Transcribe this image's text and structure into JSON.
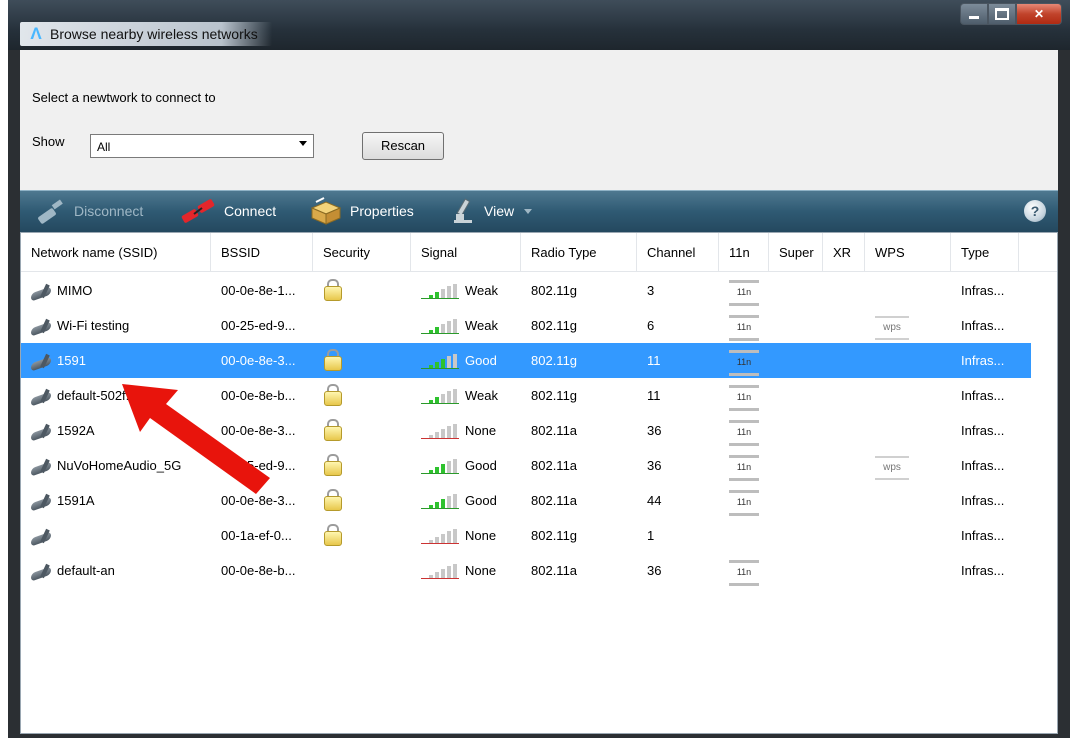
{
  "window": {
    "title": "Browse nearby wireless networks",
    "app_icon_glyph": "Λ"
  },
  "prompt": "Select a newtwork to connect to",
  "show": {
    "label": "Show",
    "selected": "All"
  },
  "rescan_label": "Rescan",
  "toolbar": {
    "disconnect": "Disconnect",
    "connect": "Connect",
    "properties": "Properties",
    "view": "View",
    "help_glyph": "?"
  },
  "columns": [
    "Network name (SSID)",
    "BSSID",
    "Security",
    "Signal",
    "Radio Type",
    "Channel",
    "11n",
    "Super",
    "XR",
    "WPS",
    "Type"
  ],
  "networks": [
    {
      "ssid": "MIMO",
      "bssid": "00-0e-8e-1...",
      "secure": true,
      "signal": "Weak",
      "bars": 2,
      "radio": "802.11g",
      "channel": "3",
      "n11": true,
      "wps": false,
      "type": "Infras...",
      "selected": false
    },
    {
      "ssid": "Wi-Fi testing",
      "bssid": "00-25-ed-9...",
      "secure": false,
      "signal": "Weak",
      "bars": 2,
      "radio": "802.11g",
      "channel": "6",
      "n11": true,
      "wps": true,
      "type": "Infras...",
      "selected": false
    },
    {
      "ssid": "1591",
      "bssid": "00-0e-8e-3...",
      "secure": true,
      "signal": "Good",
      "bars": 3,
      "radio": "802.11g",
      "channel": "11",
      "n11": true,
      "wps": false,
      "type": "Infras...",
      "selected": true
    },
    {
      "ssid": "default-502f...",
      "bssid": "00-0e-8e-b...",
      "secure": true,
      "signal": "Weak",
      "bars": 2,
      "radio": "802.11g",
      "channel": "11",
      "n11": true,
      "wps": false,
      "type": "Infras...",
      "selected": false
    },
    {
      "ssid": "1592A",
      "bssid": "00-0e-8e-3...",
      "secure": true,
      "signal": "None",
      "bars": 0,
      "radio": "802.11a",
      "channel": "36",
      "n11": true,
      "wps": false,
      "type": "Infras...",
      "selected": false
    },
    {
      "ssid": "NuVoHomeAudio_5G",
      "bssid": "00-25-ed-9...",
      "secure": true,
      "signal": "Good",
      "bars": 3,
      "radio": "802.11a",
      "channel": "36",
      "n11": true,
      "wps": true,
      "type": "Infras...",
      "selected": false
    },
    {
      "ssid": "1591A",
      "bssid": "00-0e-8e-3...",
      "secure": true,
      "signal": "Good",
      "bars": 3,
      "radio": "802.11a",
      "channel": "44",
      "n11": true,
      "wps": false,
      "type": "Infras...",
      "selected": false
    },
    {
      "ssid": "",
      "bssid": "00-1a-ef-0...",
      "secure": true,
      "signal": "None",
      "bars": 0,
      "radio": "802.11g",
      "channel": "1",
      "n11": false,
      "wps": false,
      "type": "Infras...",
      "selected": false
    },
    {
      "ssid": "default-an",
      "bssid": "00-0e-8e-b...",
      "secure": false,
      "signal": "None",
      "bars": 0,
      "radio": "802.11a",
      "channel": "36",
      "n11": true,
      "wps": false,
      "type": "Infras...",
      "selected": false
    }
  ],
  "badges": {
    "n11": "11n",
    "wps": "wps"
  },
  "colors": {
    "selection": "#3399ff",
    "toolbar": "#2f5a73",
    "annotation_arrow": "#e8140c",
    "signal_on": "#2ec22e"
  }
}
